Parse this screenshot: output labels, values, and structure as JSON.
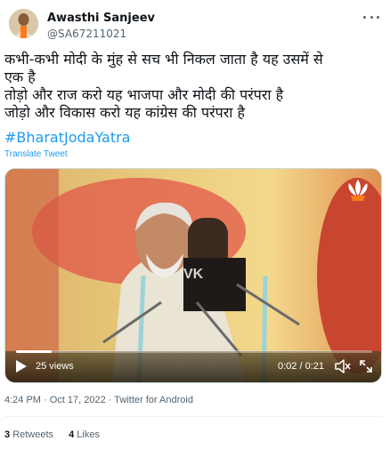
{
  "author": {
    "display_name": "Awasthi Sanjeev",
    "handle": "@SA67211021",
    "avatar_icon": "avatar"
  },
  "tweet": {
    "lines": [
      "कभी-कभी मोदी के मुंह से सच भी निकल जाता है यह उसमें से",
      "एक है",
      "तोड़ो और राज करो यह भाजपा और मोदी की परंपरा है",
      "जोड़ो और विकास करो यह कांग्रेस की परंपरा है"
    ],
    "hashtag": "#BharatJodaYatra",
    "translate_label": "Translate Tweet"
  },
  "video": {
    "watermark": "VK",
    "views_label": "25 views",
    "time_label": "0:02 / 0:21",
    "progress_fraction": 0.1
  },
  "meta": {
    "timestamp": "4:24 PM · Oct 17, 2022 · Twitter for Android"
  },
  "stats": {
    "retweets_count": "3",
    "retweets_label": "Retweets",
    "likes_count": "4",
    "likes_label": "Likes"
  },
  "colors": {
    "link": "#1d9bf0",
    "secondary_text": "#536471"
  }
}
